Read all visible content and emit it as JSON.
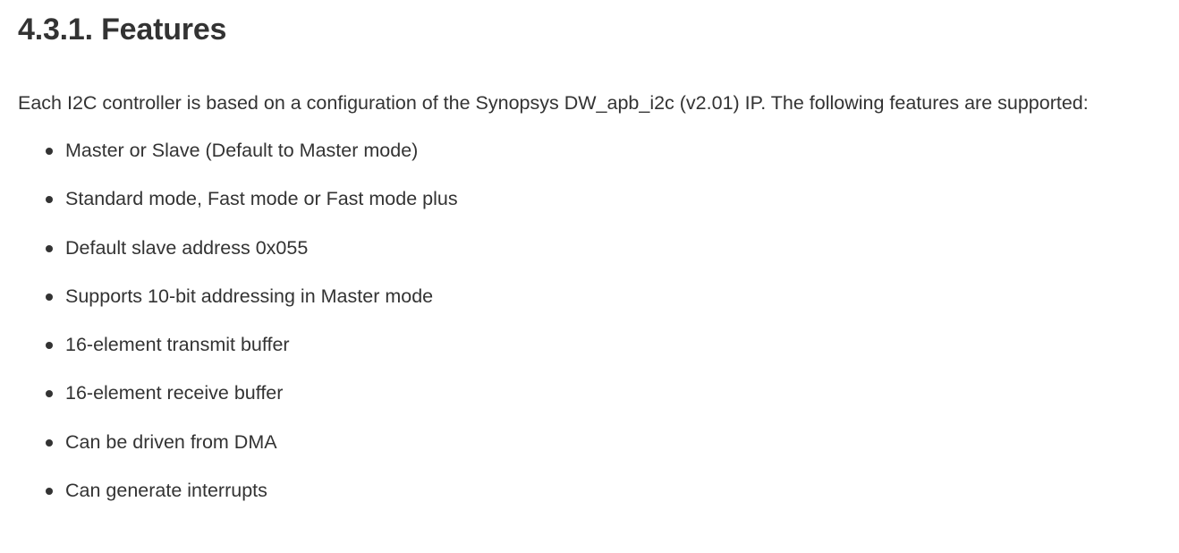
{
  "heading": "4.3.1. Features",
  "intro": "Each I2C controller is based on a configuration of the Synopsys DW_apb_i2c (v2.01) IP. The following features are supported:",
  "features": [
    "Master or Slave (Default to Master mode)",
    "Standard mode, Fast mode or Fast mode plus",
    "Default slave address 0x055",
    "Supports 10-bit addressing in Master mode",
    "16-element transmit buffer",
    "16-element receive buffer",
    "Can be driven from DMA",
    "Can generate interrupts"
  ]
}
